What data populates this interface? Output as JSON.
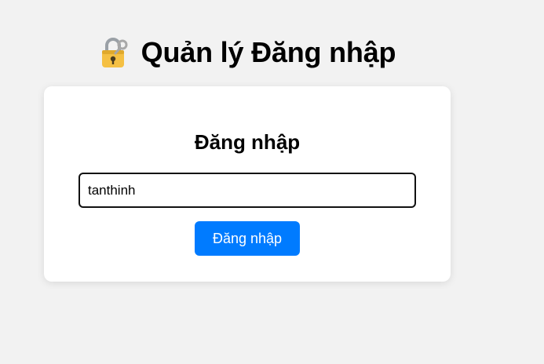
{
  "header": {
    "icon": "locked-with-key-icon",
    "title": "Quản lý Đăng nhập"
  },
  "login_form": {
    "title": "Đăng nhập",
    "username_value": "tanthinh",
    "submit_label": "Đăng nhập"
  },
  "colors": {
    "background": "#f2f2f2",
    "card": "#ffffff",
    "button": "#007bff",
    "lock_body": "#f5c043",
    "key": "#a8a8a8"
  }
}
